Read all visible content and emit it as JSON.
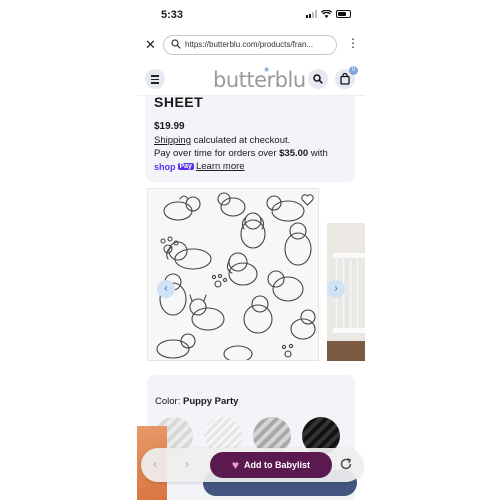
{
  "status_bar": {
    "time": "5:33"
  },
  "browser": {
    "url": "https://butterblu.com/products/fran..."
  },
  "header": {
    "logo": "butterblu",
    "cart_count": "0"
  },
  "product": {
    "title": "SHEET",
    "price": "$19.99",
    "shipping_link": "Shipping",
    "shipping_suffix": " calculated at checkout.",
    "installments_prefix": "Pay over time for orders over ",
    "installments_amount": "$35.00",
    "installments_suffix": " with",
    "shoppay_shop": "shop",
    "shoppay_pay": "Pay",
    "learn_more": "Learn more"
  },
  "gallery": {
    "prev_label": "‹",
    "next_label": "›"
  },
  "color": {
    "label": "Color:",
    "selected": "Puppy Party"
  },
  "babylist": {
    "add_label": "Add to Babylist"
  },
  "colors": {
    "accent": "#5a31f4",
    "babylist": "#5b1a4f",
    "card_bg": "#f3f4f8",
    "brand_blue": "#7aa7d8"
  }
}
